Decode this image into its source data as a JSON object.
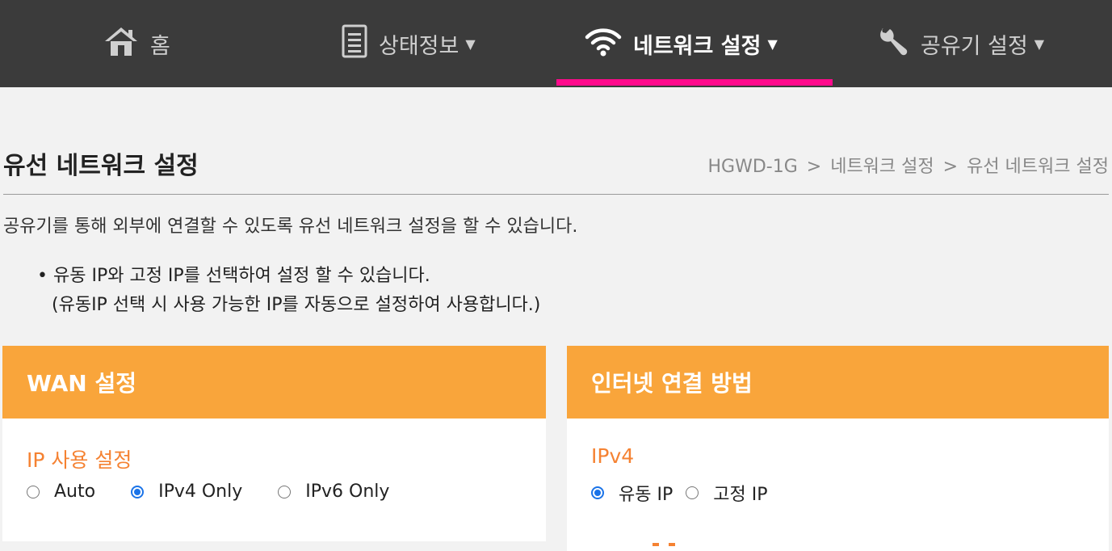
{
  "nav": {
    "items": [
      {
        "label": "홈",
        "icon": "home-icon",
        "caret": ""
      },
      {
        "label": "상태정보",
        "icon": "document-icon",
        "caret": "▼"
      },
      {
        "label": "네트워크 설정",
        "icon": "wifi-icon",
        "caret": "▼",
        "active": true
      },
      {
        "label": "공유기 설정",
        "icon": "wrench-icon",
        "caret": "▼"
      }
    ],
    "indicator_color": "#ff0a8c"
  },
  "page": {
    "title": "유선 네트워크 설정",
    "breadcrumb": [
      "HGWD-1G",
      "네트워크 설정",
      "유선 네트워크 설정"
    ],
    "breadcrumb_sep": ">",
    "description": "공유기를 통해 외부에 연결할 수 있도록 유선 네트워크 설정을 할 수 있습니다.",
    "note_bullet": "•",
    "note_line1": "유동 IP와 고정 IP를 선택하여 설정 할 수 있습니다.",
    "note_line2": "(유동IP 선택 시 사용 가능한 IP를 자동으로 설정하여 사용합니다.)"
  },
  "wan_panel": {
    "title": "WAN 설정",
    "section_label": "IP 사용 설정",
    "options": [
      {
        "label": "Auto",
        "checked": false
      },
      {
        "label": "IPv4 Only",
        "checked": true
      },
      {
        "label": "IPv6 Only",
        "checked": false
      }
    ]
  },
  "internet_panel": {
    "title": "인터넷 연결 방법",
    "section_label": "IPv4",
    "options": [
      {
        "label": "유동 IP",
        "checked": true
      },
      {
        "label": "고정 IP",
        "checked": false
      }
    ]
  },
  "colors": {
    "nav_bg": "#3b3b3b",
    "accent_orange": "#f9a53b",
    "label_orange": "#f58232",
    "radio_blue": "#1a73e8"
  }
}
